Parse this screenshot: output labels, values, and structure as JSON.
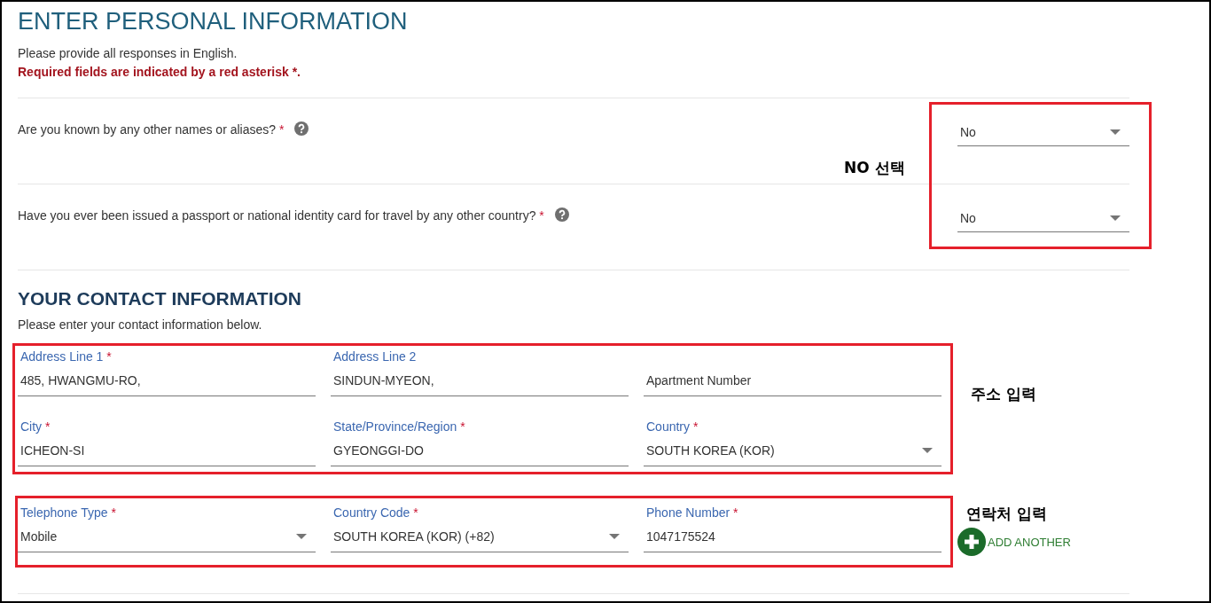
{
  "header": {
    "title": "ENTER PERSONAL INFORMATION",
    "intro": "Please provide all responses in English.",
    "required_note": "Required fields are indicated by a red asterisk *."
  },
  "questions": [
    {
      "label": "Are you known by any other names or aliases?",
      "required_mark": "*",
      "help": true,
      "value": "No"
    },
    {
      "label": "Have you ever been issued a passport or national identity card for travel by any other country?",
      "required_mark": "*",
      "help": true,
      "value": "No"
    }
  ],
  "contact": {
    "title": "YOUR CONTACT INFORMATION",
    "intro": "Please enter your contact information below.",
    "address_fields": [
      {
        "kind": "text",
        "label": "Address Line 1",
        "required_mark": "*",
        "value": "485, HWANGMU-RO,"
      },
      {
        "kind": "text",
        "label": "Address Line 2",
        "value": "SINDUN-MYEON,"
      },
      {
        "kind": "text",
        "placeholder": "Apartment Number"
      },
      {
        "kind": "text",
        "label": "City",
        "required_mark": "*",
        "value": "ICHEON-SI"
      },
      {
        "kind": "text",
        "label": "State/Province/Region",
        "required_mark": "*",
        "value": "GYEONGGI-DO"
      },
      {
        "kind": "select",
        "label": "Country",
        "required_mark": "*",
        "value": "SOUTH KOREA (KOR)"
      }
    ],
    "phone_fields": [
      {
        "kind": "select",
        "label": "Telephone Type",
        "required_mark": "*",
        "value": "Mobile"
      },
      {
        "kind": "select",
        "label": "Country Code",
        "required_mark": "*",
        "value": "SOUTH KOREA (KOR) (+82)"
      },
      {
        "kind": "text",
        "label": "Phone Number",
        "required_mark": "*",
        "value": "1047175524"
      }
    ],
    "add_button": "ADD ANOTHER"
  },
  "annotations": [
    {
      "text": "NO 선택"
    },
    {
      "text": "주소 입력"
    },
    {
      "text": "연락처 입력"
    }
  ]
}
